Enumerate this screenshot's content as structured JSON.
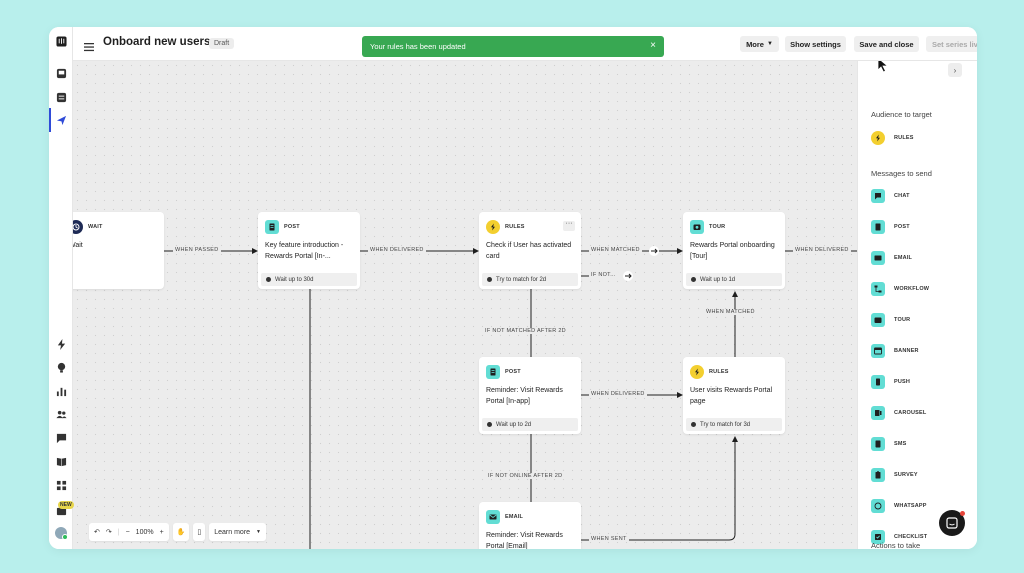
{
  "header": {
    "title": "Onboard new users",
    "status": "Draft",
    "toast": "Your rules has been updated",
    "more": "More",
    "show_settings": "Show settings",
    "save_close": "Save and close",
    "set_live": "Set series live"
  },
  "nodes": {
    "wait": {
      "type": "WAIT",
      "text": "Wait"
    },
    "post1": {
      "type": "POST",
      "text": "Key feature introduction - Rewards Portal [In-...",
      "foot": "Wait up to 30d"
    },
    "rules1": {
      "type": "RULES",
      "text": "Check if User has activated card",
      "foot": "Try to match for 2d"
    },
    "tour": {
      "type": "TOUR",
      "text": "Rewards Portal onboarding [Tour]",
      "foot": "Wait up to 1d"
    },
    "post2": {
      "type": "POST",
      "text": "Reminder: Visit Rewards Portal [In-app]",
      "foot": "Wait up to 2d"
    },
    "rules2": {
      "type": "RULES",
      "text": "User visits Rewards Portal page",
      "foot": "Try to match for 3d"
    },
    "email": {
      "type": "EMAIL",
      "text": "Reminder: Visit Rewards Portal [Email]"
    }
  },
  "edges": {
    "when_passed": "WHEN PASSED",
    "when_delivered_1": "WHEN DELIVERED",
    "when_matched_1": "WHEN MATCHED",
    "if_not": "IF NOT...",
    "when_delivered_2": "WHEN DELIVERED",
    "if_not_matched": "IF NOT MATCHED AFTER 2D",
    "when_delivered_3": "WHEN DELIVERED",
    "when_matched_2": "WHEN MATCHED",
    "if_not_online": "IF NOT ONLINE AFTER 2D",
    "when_sent": "WHEN SENT"
  },
  "toolbar": {
    "zoom": "100%",
    "learn_more": "Learn more"
  },
  "rail": {
    "new_badge": "NEW"
  },
  "panel": {
    "audience_title": "Audience to target",
    "audience_items": [
      {
        "label": "RULES",
        "icon": "bolt-icon"
      }
    ],
    "messages_title": "Messages to send",
    "message_items": [
      {
        "label": "CHAT",
        "icon": "chat-icon"
      },
      {
        "label": "POST",
        "icon": "post-icon"
      },
      {
        "label": "EMAIL",
        "icon": "email-icon"
      },
      {
        "label": "WORKFLOW",
        "icon": "workflow-icon"
      },
      {
        "label": "TOUR",
        "icon": "tour-icon"
      },
      {
        "label": "BANNER",
        "icon": "banner-icon"
      },
      {
        "label": "PUSH",
        "icon": "push-icon"
      },
      {
        "label": "CAROUSEL",
        "icon": "carousel-icon"
      },
      {
        "label": "SMS",
        "icon": "sms-icon"
      },
      {
        "label": "SURVEY",
        "icon": "survey-icon"
      },
      {
        "label": "WHATSAPP",
        "icon": "whatsapp-icon"
      },
      {
        "label": "CHECKLIST",
        "icon": "checklist-icon"
      }
    ],
    "actions_title": "Actions to take"
  },
  "colors": {
    "accent_teal": "#62ddd4",
    "rules_yellow": "#f3cf2f",
    "toast_green": "#38a852",
    "background": "#b8efec"
  }
}
